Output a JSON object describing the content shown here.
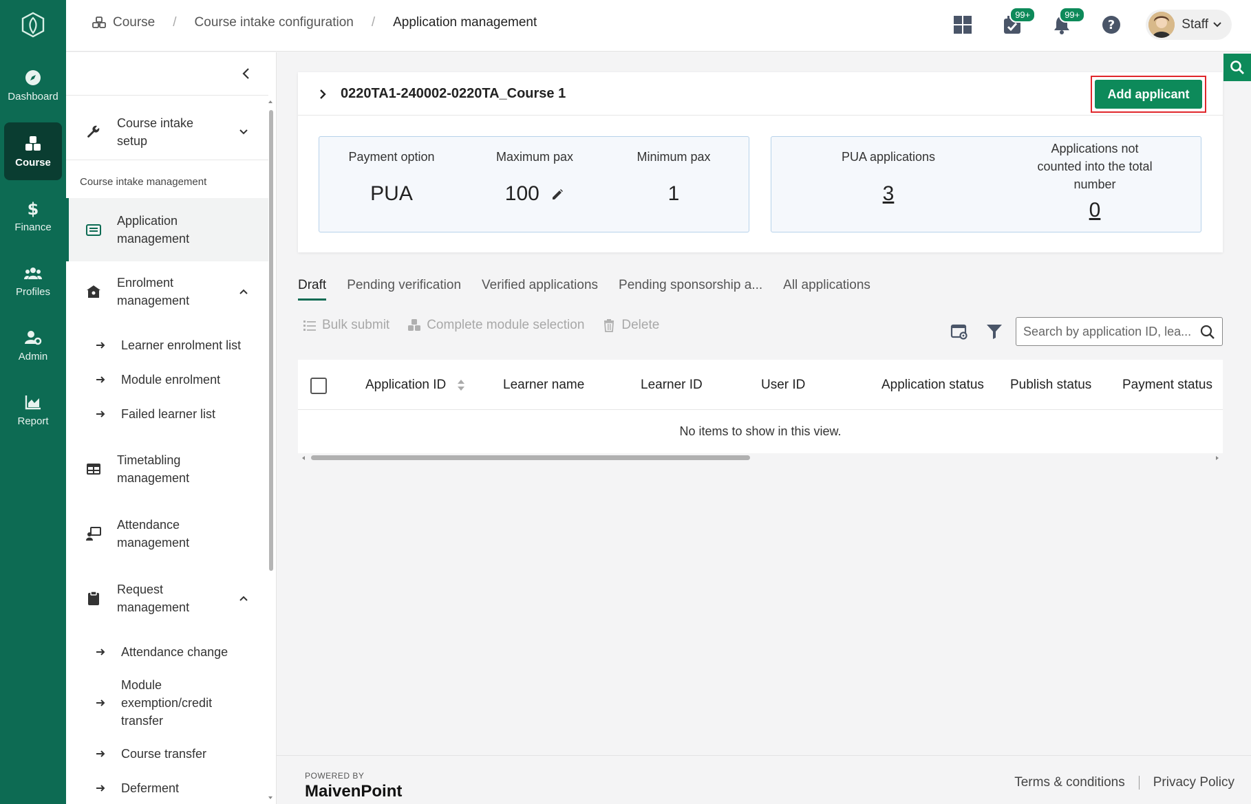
{
  "rail": {
    "items": [
      {
        "label": "Dashboard"
      },
      {
        "label": "Course"
      },
      {
        "label": "Finance"
      },
      {
        "label": "Profiles"
      },
      {
        "label": "Admin"
      },
      {
        "label": "Report"
      }
    ],
    "active": "Course"
  },
  "breadcrumb": {
    "items": [
      "Course",
      "Course intake configuration",
      "Application management"
    ]
  },
  "topbar": {
    "tasks_badge": "99+",
    "notifications_badge": "99+",
    "user_label": "Staff"
  },
  "sidebar": {
    "course_intake_setup": "Course intake setup",
    "section_label": "Course intake management",
    "application_management": "Application management",
    "enrolment_management": "Enrolment management",
    "enrolment_sub": [
      "Learner enrolment list",
      "Module enrolment",
      "Failed learner list"
    ],
    "timetabling_management": "Timetabling management",
    "attendance_management": "Attendance management",
    "request_management": "Request management",
    "request_sub": [
      "Attendance change",
      "Module exemption/credit transfer",
      "Course transfer",
      "Deferment"
    ]
  },
  "card": {
    "title": "0220TA1-240002-0220TA_Course 1",
    "add_button": "Add applicant",
    "stats_left": [
      {
        "label": "Payment option",
        "value": "PUA"
      },
      {
        "label": "Maximum pax",
        "value": "100"
      },
      {
        "label": "Minimum pax",
        "value": "1"
      }
    ],
    "stats_right": [
      {
        "label": "PUA applications",
        "value": "3"
      },
      {
        "label": "Applications not counted into the total number",
        "value": "0"
      }
    ]
  },
  "tabs": [
    "Draft",
    "Pending verification",
    "Verified applications",
    "Pending sponsorship a...",
    "All applications"
  ],
  "toolbar": {
    "bulk_submit": "Bulk submit",
    "complete_module_selection": "Complete module selection",
    "delete": "Delete",
    "search_placeholder": "Search by application ID, lea..."
  },
  "table": {
    "columns": [
      "Application ID",
      "Learner name",
      "Learner ID",
      "User ID",
      "Application status",
      "Publish status",
      "Payment status"
    ],
    "empty_message": "No items to show in this view."
  },
  "footer": {
    "powered_by": "POWERED BY",
    "brand": "MaivenPoint",
    "terms": "Terms & conditions",
    "privacy": "Privacy Policy"
  },
  "colors": {
    "rail": "#0d6b53",
    "primary": "#0d8a5a",
    "highlight_border": "#e0262b"
  }
}
